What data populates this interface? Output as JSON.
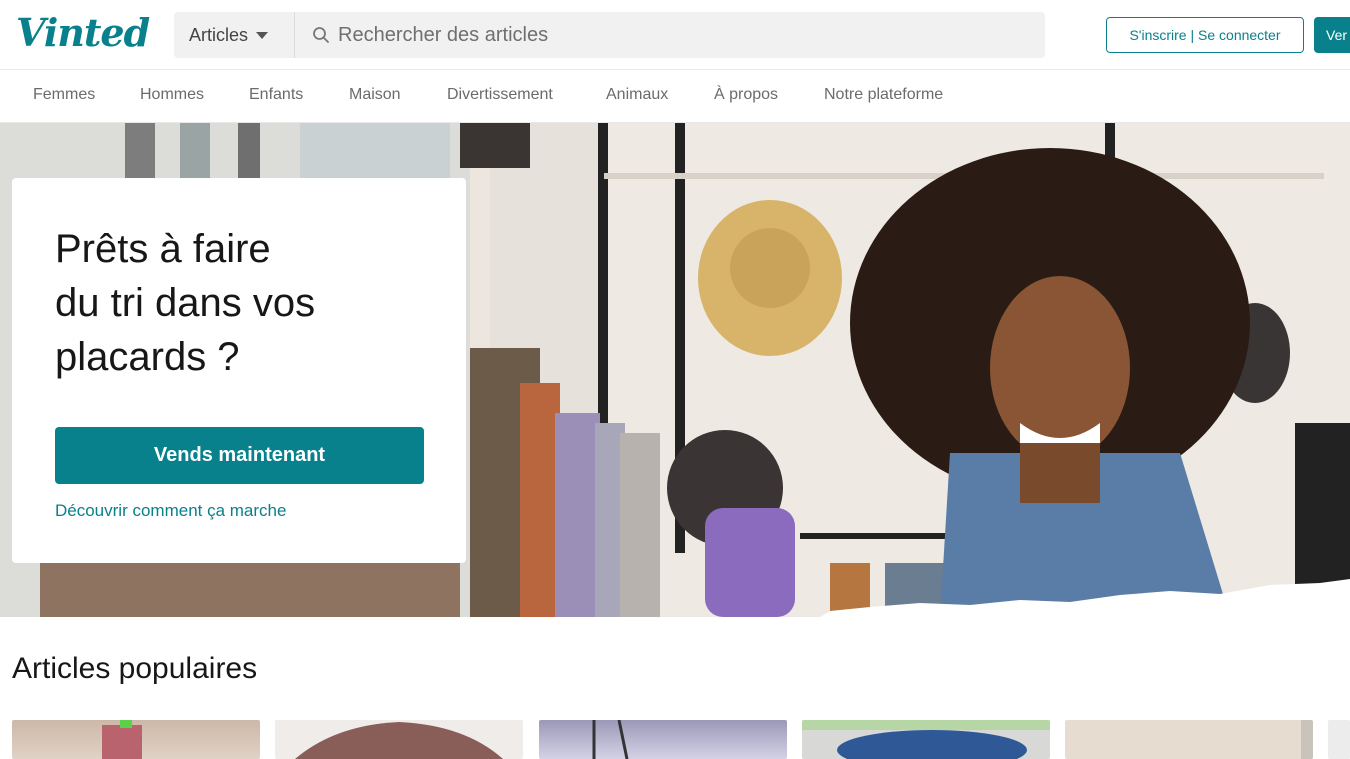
{
  "header": {
    "logo": "Vinted",
    "search_category": "Articles",
    "search_placeholder": "Rechercher des articles",
    "login_label": "S'inscrire | Se connecter",
    "sell_label": "Ver"
  },
  "nav": {
    "items": [
      {
        "label": "Femmes"
      },
      {
        "label": "Hommes"
      },
      {
        "label": "Enfants"
      },
      {
        "label": "Maison"
      },
      {
        "label": "Divertissement"
      },
      {
        "label": "Animaux"
      },
      {
        "label": "À propos"
      },
      {
        "label": "Notre plateforme"
      }
    ]
  },
  "hero": {
    "title_line1": "Prêts à faire",
    "title_line2": "du tri dans vos",
    "title_line3": "placards ?",
    "cta_label": "Vends maintenant",
    "link_label": "Découvrir comment ça marche"
  },
  "popular": {
    "title": "Articles populaires"
  },
  "colors": {
    "brand": "#09818c",
    "text": "#171717",
    "muted": "#6b6b6b"
  },
  "icons": {
    "search": "search-icon",
    "caret": "chevron-down-icon"
  }
}
